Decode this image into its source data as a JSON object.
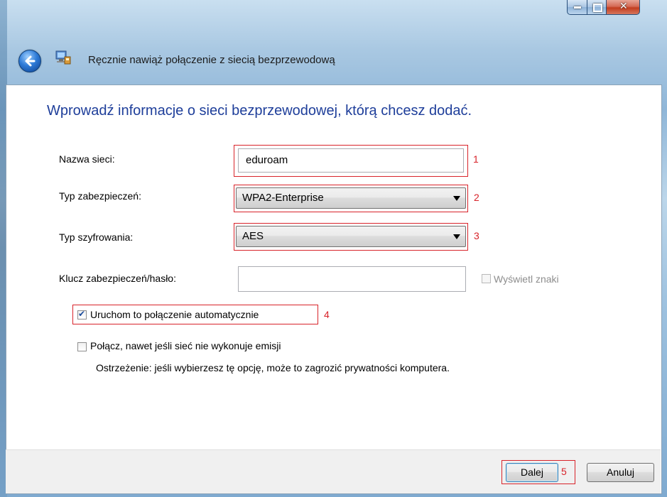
{
  "window": {
    "title": "Ręcznie nawiąż połączenie z siecią bezprzewodową",
    "caption_buttons": {
      "minimize": "minimize-icon",
      "maximize": "maximize-icon",
      "close": "close-icon"
    },
    "back_icon": "back-arrow-icon",
    "title_icon": "wireless-network-icon"
  },
  "main": {
    "heading": "Wprowadź informacje o sieci bezprzewodowej, którą chcesz dodać.",
    "network_name_label": "Nazwa sieci:",
    "network_name_value": "eduroam",
    "security_type_label": "Typ zabezpieczeń:",
    "security_type_value": "WPA2-Enterprise",
    "encryption_type_label": "Typ szyfrowania:",
    "encryption_type_value": "AES",
    "security_key_label": "Klucz zabezpieczeń/hasło:",
    "security_key_value": "",
    "show_characters_label": "Wyświetl znaki",
    "auto_start_label": "Uruchom to połączenie automatycznie",
    "auto_start_checked": true,
    "connect_hidden_label": "Połącz, nawet jeśli sieć nie wykonuje emisji",
    "connect_hidden_checked": false,
    "warning_text": "Ostrzeżenie: jeśli wybierzesz tę opcję, może to zagrozić prywatności komputera."
  },
  "annotations": [
    "1",
    "2",
    "3",
    "4",
    "5"
  ],
  "footer": {
    "next_label": "Dalej",
    "cancel_label": "Anuluj"
  },
  "colors": {
    "highlight": "#d8232a",
    "heading": "#1e3e9a"
  }
}
